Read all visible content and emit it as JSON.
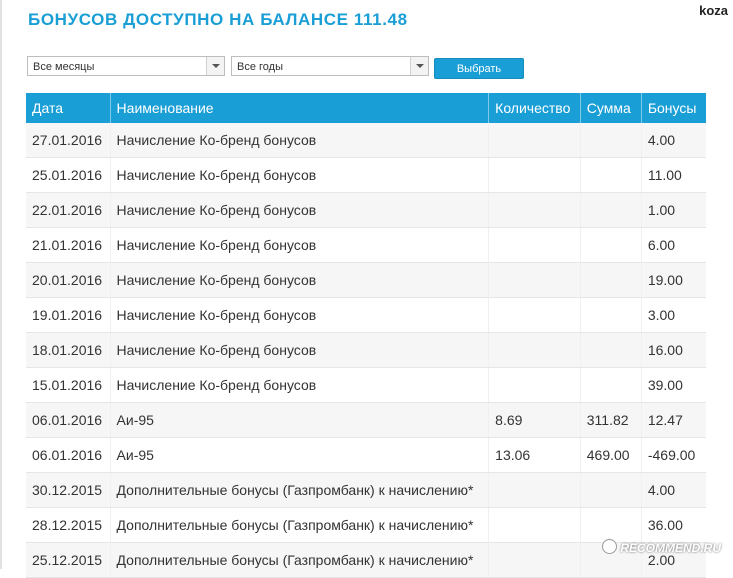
{
  "header": {
    "title": "БОНУСОВ ДОСТУПНО НА БАЛАНСЕ 111.48",
    "user": "koza"
  },
  "filters": {
    "month_value": "Все месяцы",
    "year_value": "Все годы",
    "submit_label": "Выбрать"
  },
  "table": {
    "columns": [
      "Дата",
      "Наименование",
      "Количество",
      "Сумма",
      "Бонусы"
    ],
    "rows": [
      {
        "date": "27.01.2016",
        "name": "Начисление Ко-бренд бонусов",
        "qty": "",
        "sum": "",
        "bonus": "4.00"
      },
      {
        "date": "25.01.2016",
        "name": "Начисление Ко-бренд бонусов",
        "qty": "",
        "sum": "",
        "bonus": "11.00"
      },
      {
        "date": "22.01.2016",
        "name": "Начисление Ко-бренд бонусов",
        "qty": "",
        "sum": "",
        "bonus": "1.00"
      },
      {
        "date": "21.01.2016",
        "name": "Начисление Ко-бренд бонусов",
        "qty": "",
        "sum": "",
        "bonus": "6.00"
      },
      {
        "date": "20.01.2016",
        "name": "Начисление Ко-бренд бонусов",
        "qty": "",
        "sum": "",
        "bonus": "19.00"
      },
      {
        "date": "19.01.2016",
        "name": "Начисление Ко-бренд бонусов",
        "qty": "",
        "sum": "",
        "bonus": "3.00"
      },
      {
        "date": "18.01.2016",
        "name": "Начисление Ко-бренд бонусов",
        "qty": "",
        "sum": "",
        "bonus": "16.00"
      },
      {
        "date": "15.01.2016",
        "name": "Начисление Ко-бренд бонусов",
        "qty": "",
        "sum": "",
        "bonus": "39.00"
      },
      {
        "date": "06.01.2016",
        "name": "Аи-95",
        "qty": "8.69",
        "sum": "311.82",
        "bonus": "12.47"
      },
      {
        "date": "06.01.2016",
        "name": "Аи-95",
        "qty": "13.06",
        "sum": "469.00",
        "bonus": "-469.00"
      },
      {
        "date": "30.12.2015",
        "name": "Дополнительные бонусы (Газпромбанк) к начислению*",
        "qty": "",
        "sum": "",
        "bonus": "4.00"
      },
      {
        "date": "28.12.2015",
        "name": "Дополнительные бонусы (Газпромбанк) к начислению*",
        "qty": "",
        "sum": "",
        "bonus": "36.00"
      },
      {
        "date": "25.12.2015",
        "name": "Дополнительные бонусы (Газпромбанк) к начислению*",
        "qty": "",
        "sum": "",
        "bonus": "2.00"
      }
    ]
  },
  "watermark": {
    "text": "RECOMMEND.RU"
  }
}
